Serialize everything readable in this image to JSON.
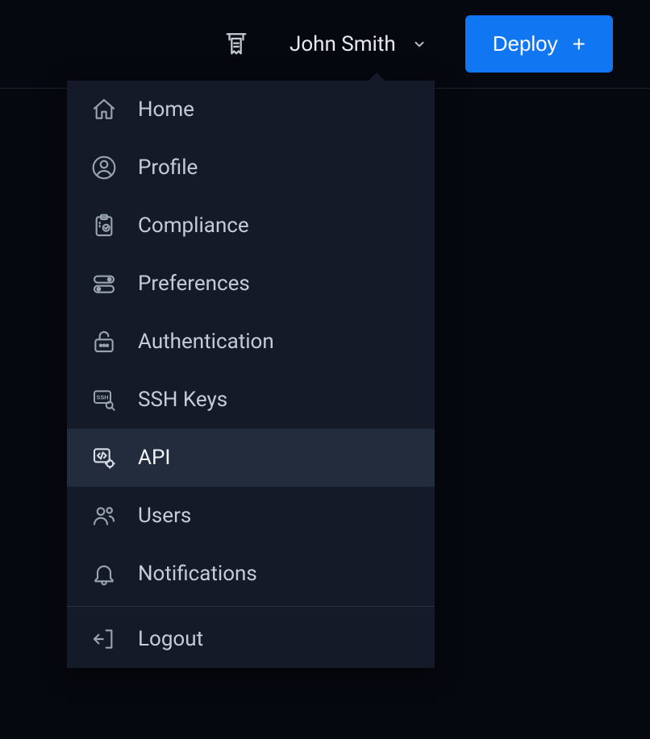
{
  "header": {
    "user_name": "John Smith",
    "deploy_label": "Deploy",
    "deploy_plus": "+"
  },
  "menu": {
    "items": [
      {
        "icon": "home-icon",
        "label": "Home",
        "active": false
      },
      {
        "icon": "profile-icon",
        "label": "Profile",
        "active": false
      },
      {
        "icon": "compliance-icon",
        "label": "Compliance",
        "active": false
      },
      {
        "icon": "preferences-icon",
        "label": "Preferences",
        "active": false
      },
      {
        "icon": "authentication-icon",
        "label": "Authentication",
        "active": false
      },
      {
        "icon": "ssh-keys-icon",
        "label": "SSH Keys",
        "active": false
      },
      {
        "icon": "api-icon",
        "label": "API",
        "active": true
      },
      {
        "icon": "users-icon",
        "label": "Users",
        "active": false
      },
      {
        "icon": "notifications-icon",
        "label": "Notifications",
        "active": false
      }
    ],
    "logout_label": "Logout"
  }
}
